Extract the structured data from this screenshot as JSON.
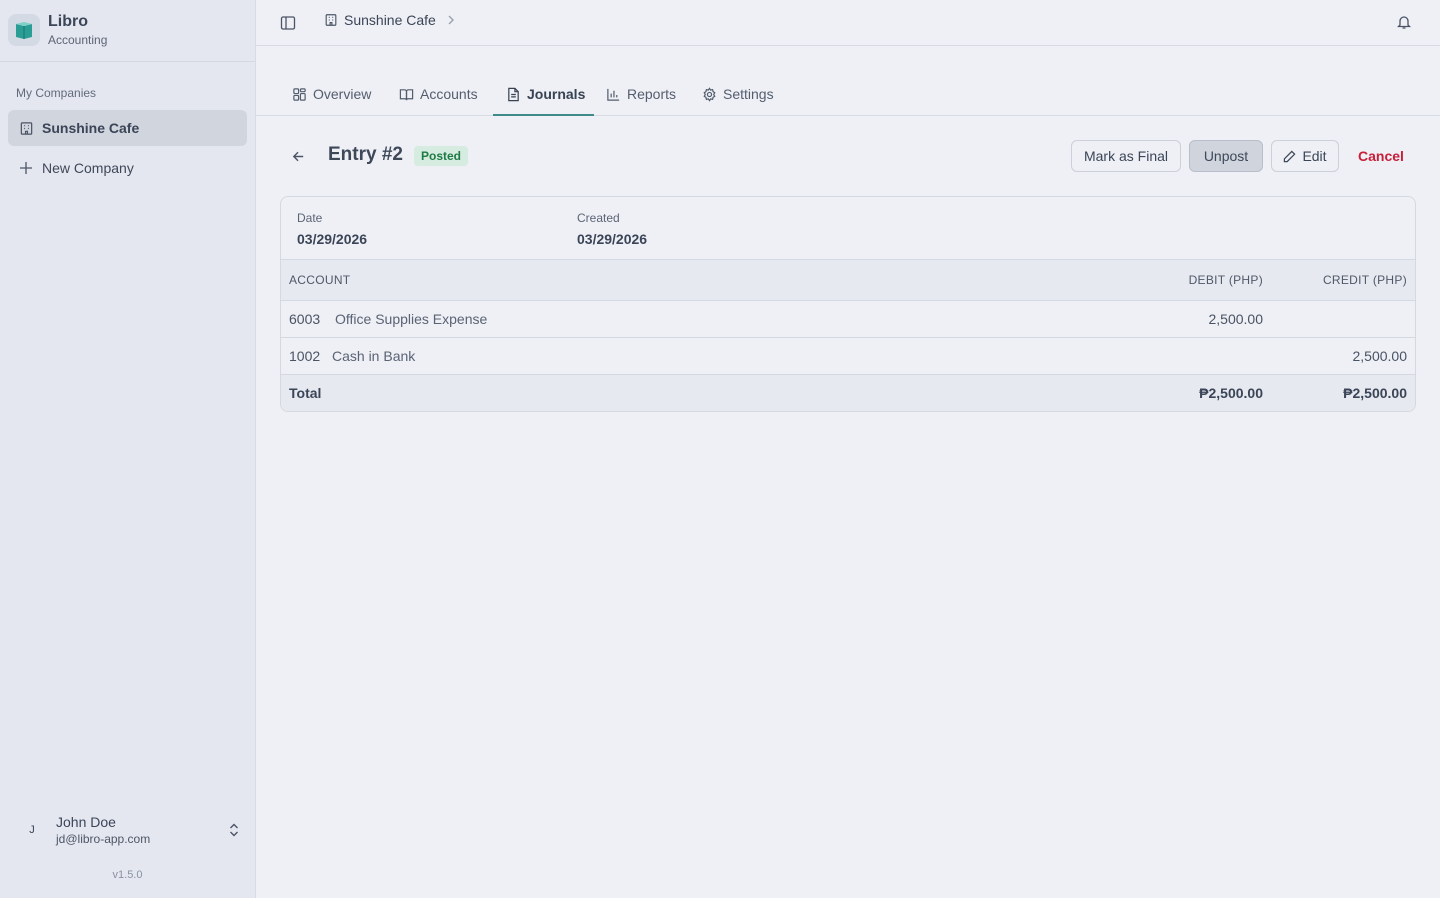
{
  "app": {
    "name": "Libro",
    "subtitle": "Accounting"
  },
  "sidebar": {
    "section_label": "My Companies",
    "items": [
      {
        "label": "Sunshine Cafe",
        "icon": "building-icon",
        "active": true
      },
      {
        "label": "New Company",
        "icon": "plus-icon",
        "active": false
      }
    ],
    "user": {
      "initial": "J",
      "name": "John Doe",
      "email": "jd@libro-app.com"
    },
    "version": "v1.5.0"
  },
  "topbar": {
    "breadcrumb": "Sunshine Cafe"
  },
  "tabs": [
    {
      "label": "Overview",
      "icon": "grid-icon"
    },
    {
      "label": "Accounts",
      "icon": "book-icon"
    },
    {
      "label": "Journals",
      "icon": "document-icon",
      "active": true
    },
    {
      "label": "Reports",
      "icon": "bar-chart-icon"
    },
    {
      "label": "Settings",
      "icon": "gear-icon"
    }
  ],
  "entry": {
    "title": "Entry #2",
    "status": "Posted",
    "actions": {
      "mark_final": "Mark as Final",
      "unpost": "Unpost",
      "edit": "Edit",
      "cancel": "Cancel"
    },
    "date_label": "Date",
    "date": "03/29/2026",
    "created_label": "Created",
    "created": "03/29/2026",
    "table": {
      "headers": {
        "account": "ACCOUNT",
        "debit": "DEBIT (PHP)",
        "credit": "CREDIT (PHP)"
      },
      "rows": [
        {
          "code": "6003",
          "name": "Office Supplies Expense",
          "debit": "2,500.00",
          "credit": ""
        },
        {
          "code": "1002",
          "name": "Cash in Bank",
          "debit": "",
          "credit": "2,500.00"
        }
      ],
      "total": {
        "label": "Total",
        "debit": "₱2,500.00",
        "credit": "₱2,500.00"
      }
    }
  },
  "colors": {
    "accent": "#3d8c8a",
    "posted_bg": "#d6ece0",
    "posted_text": "#1f7a45",
    "danger": "#c81e3a"
  }
}
